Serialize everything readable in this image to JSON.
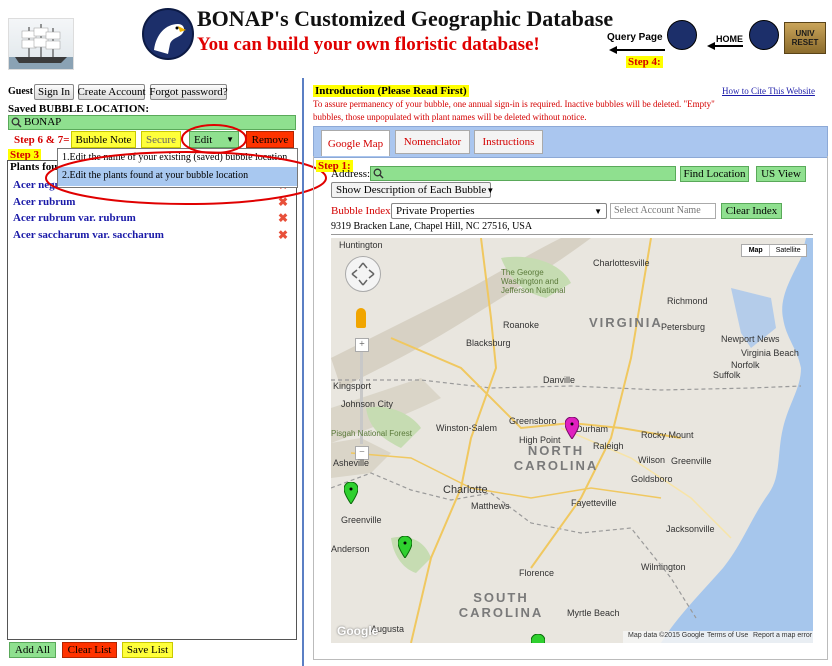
{
  "header": {
    "title": "BONAP's Customized Geographic Database",
    "subtitle": "You can build your own floristic database!",
    "query_page": "Query Page",
    "home": "HOME",
    "step4": "Step 4:",
    "univ_reset": "UNIV RESET"
  },
  "left_panel": {
    "guest": "Guest",
    "sign_in": "Sign In",
    "create_account": "Create Account",
    "forgot_password": "Forgot password?",
    "saved_label": "Saved BUBBLE LOCATION:",
    "saved_value": "BONAP",
    "step67": "Step 6 & 7=",
    "bubble_note": "Bubble Note",
    "secure": "Secure",
    "edit": "Edit",
    "remove": "Remove",
    "step3": "Step 3",
    "plants_found": "Plants found",
    "edit_menu": [
      "1.Edit the name of your existing (saved) bubble location",
      "2.Edit the plants found at your bubble location"
    ],
    "plants": [
      "Acer negundo",
      "Acer rubrum",
      "Acer rubrum var. rubrum",
      "Acer saccharum var. saccharum"
    ],
    "add_all": "Add All",
    "clear_list": "Clear List",
    "save_list": "Save List"
  },
  "right_panel": {
    "intro_title": "Introduction (Please Read First)",
    "intro_text": "To assure permanency of your bubble, one annual sign-in is required. Inactive bubbles will be deleted. \"Empty\" bubbles, those unpopulated with plant names will be deleted without notice.",
    "cite": "How to Cite This Website",
    "tabs": [
      "Google Map",
      "Nomenclator",
      "Instructions"
    ],
    "step1": "Step 1:",
    "address_label": "Address:",
    "address_value": "",
    "find_location": "Find Location",
    "us_view": "US View",
    "show_desc": "Show Description of Each Bubble",
    "bubble_index_label": "Bubble Index:",
    "bubble_index_value": "Private Properties",
    "select_account_placeholder": "Select Account Name",
    "clear_index": "Clear Index",
    "address_line": "9319 Bracken Lane, Chapel Hill, NC 27516, USA"
  },
  "map": {
    "map_btn": "Map",
    "satellite_btn": "Satellite",
    "attribution": "Map data ©2015 Google",
    "terms": "Terms of Use",
    "report": "Report a map error",
    "google": "Google",
    "states": [
      "VIRGINIA",
      "NORTH CAROLINA",
      "SOUTH CAROLINA"
    ],
    "forests": [
      "The George Washington and Jefferson National",
      "Pisgah National Forest"
    ],
    "cities": [
      "Huntington",
      "Charlottesville",
      "Richmond",
      "Roanoke",
      "Petersburg",
      "Blacksburg",
      "Virginia Beach",
      "Newport News",
      "Norfolk",
      "Suffolk",
      "Danville",
      "Kingsport",
      "Johnson City",
      "Winston-Salem",
      "Greensboro",
      "Durham",
      "High Point",
      "Raleigh",
      "Rocky Mount",
      "Greenville",
      "Wilson",
      "Goldsboro",
      "Asheville",
      "Charlotte",
      "Matthews",
      "Fayetteville",
      "Jacksonville",
      "Wilmington",
      "Greenville",
      "Anderson",
      "Florence",
      "Myrtle Beach",
      "Augusta"
    ]
  }
}
